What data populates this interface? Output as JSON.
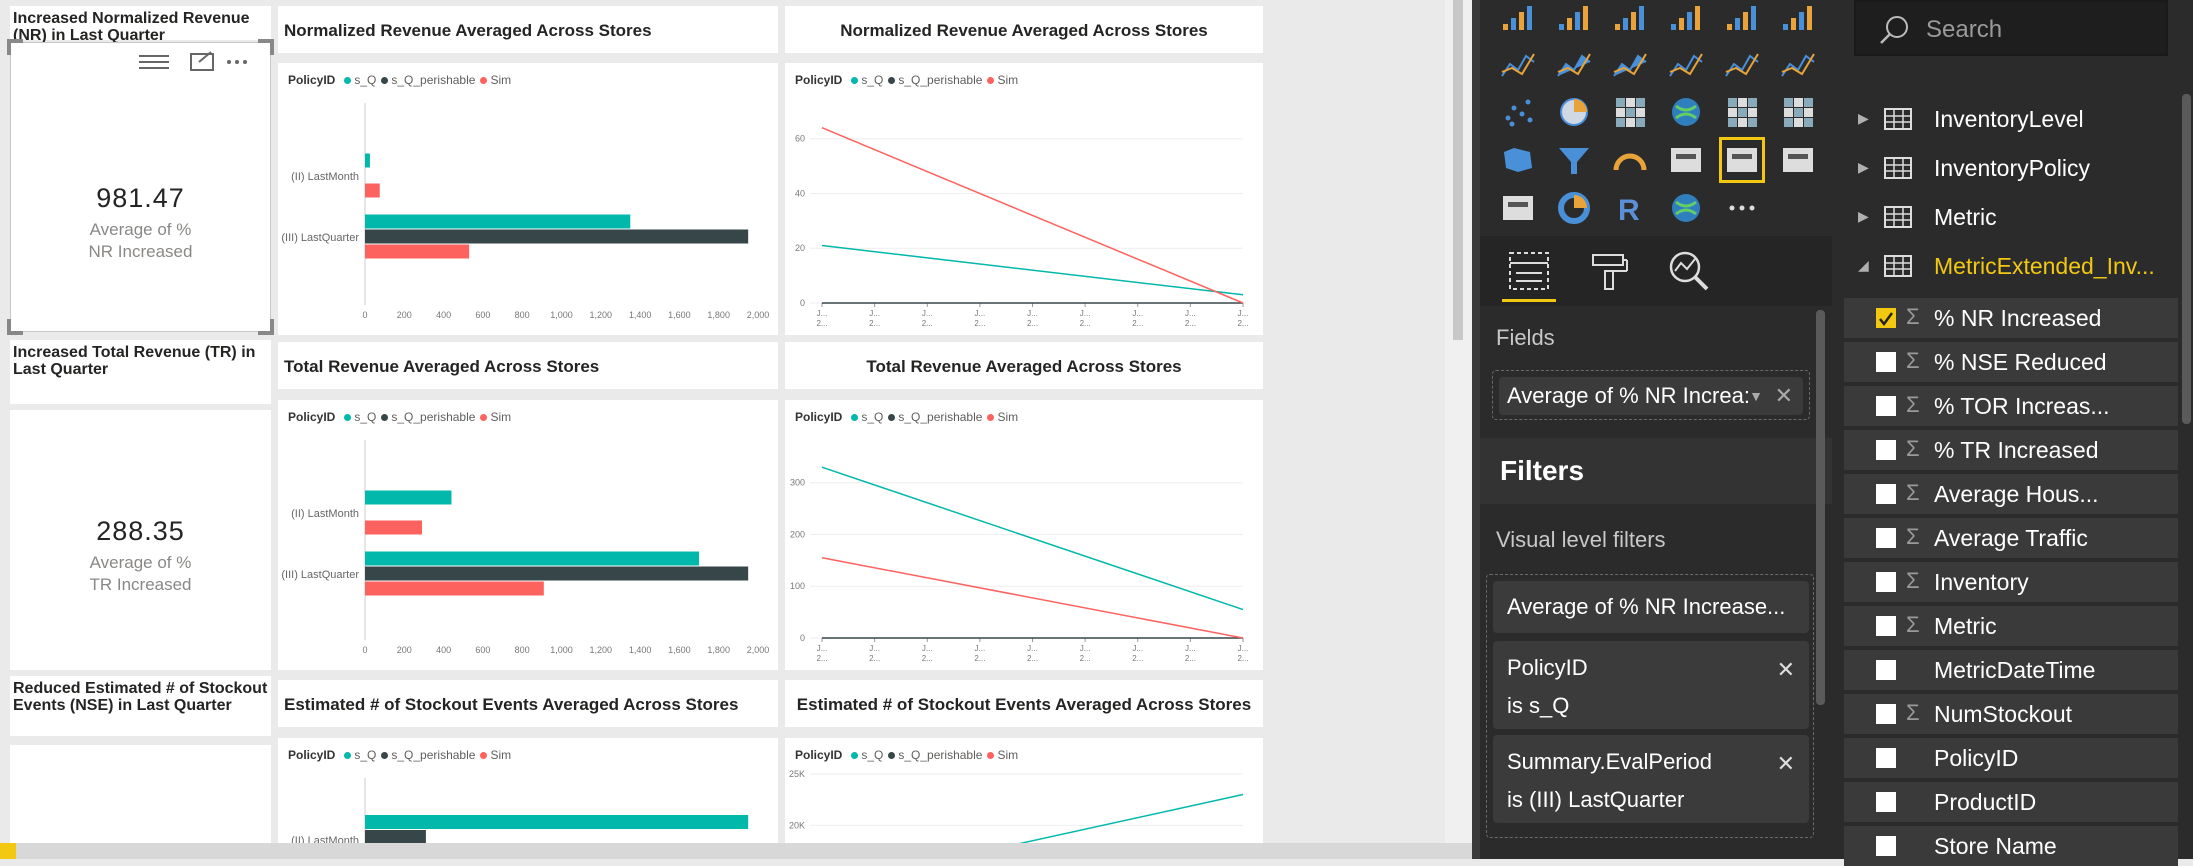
{
  "colors": {
    "sQ": "#01b8aa",
    "sQp": "#374649",
    "sim": "#fd625e",
    "accent": "#f2c811"
  },
  "kpis": [
    {
      "title": "Increased Normalized Revenue (NR) in Last Quarter",
      "value": "981.47",
      "sub": "Average of % NR Increased"
    },
    {
      "title": "Increased Total Revenue (TR) in Last Quarter",
      "value": "288.35",
      "sub": "Average of % TR Increased"
    },
    {
      "title": "Reduced Estimated # of Stockout Events (NSE) in Last Quarter",
      "value": "",
      "sub": ""
    }
  ],
  "legend": {
    "title": "PolicyID",
    "items": [
      "s_Q",
      "s_Q_perishable",
      "Sim"
    ]
  },
  "charts": [
    {
      "title": "Normalized Revenue Averaged Across Stores",
      "chart_data": {
        "type": "bar",
        "orientation": "horizontal",
        "categories": [
          "(II) LastMonth",
          "(III) LastQuarter"
        ],
        "series": [
          {
            "name": "s_Q",
            "values": [
              25,
              1350
            ]
          },
          {
            "name": "s_Q_perishable",
            "values": [
              0,
              1950
            ]
          },
          {
            "name": "Sim",
            "values": [
              75,
              530
            ]
          }
        ],
        "xlim": [
          0,
          2000
        ],
        "xticks": [
          "0",
          "200",
          "400",
          "600",
          "800",
          "1,000",
          "1,200",
          "1,400",
          "1,600",
          "1,800",
          "2,000"
        ]
      }
    },
    {
      "title": "Normalized Revenue Averaged Across Stores",
      "chart_data": {
        "type": "line",
        "x": [
          "J...",
          "J...",
          "J...",
          "J...",
          "J...",
          "J...",
          "J...",
          "J...",
          "J..."
        ],
        "series": [
          {
            "name": "s_Q",
            "values": [
              21,
              3
            ]
          },
          {
            "name": "s_Q_perishable",
            "values": [
              0,
              0
            ]
          },
          {
            "name": "Sim",
            "values": [
              64,
              0
            ]
          }
        ],
        "ylim": [
          0,
          65
        ],
        "yticks": [
          "0",
          "20",
          "40",
          "60"
        ]
      }
    },
    {
      "title": "Total Revenue Averaged Across Stores",
      "chart_data": {
        "type": "bar",
        "orientation": "horizontal",
        "categories": [
          "(II) LastMonth",
          "(III) LastQuarter"
        ],
        "series": [
          {
            "name": "s_Q",
            "values": [
              440,
              1700
            ]
          },
          {
            "name": "s_Q_perishable",
            "values": [
              0,
              1950
            ]
          },
          {
            "name": "Sim",
            "values": [
              290,
              910
            ]
          }
        ],
        "xlim": [
          0,
          2000
        ],
        "xticks": [
          "0",
          "200",
          "400",
          "600",
          "800",
          "1,000",
          "1,200",
          "1,400",
          "1,600",
          "1,800",
          "2,000"
        ]
      }
    },
    {
      "title": "Total Revenue Averaged Across Stores",
      "chart_data": {
        "type": "line",
        "x": [
          "J...",
          "J...",
          "J...",
          "J...",
          "J...",
          "J...",
          "J...",
          "J...",
          "J..."
        ],
        "series": [
          {
            "name": "s_Q",
            "values": [
              330,
              55
            ]
          },
          {
            "name": "s_Q_perishable",
            "values": [
              0,
              0
            ]
          },
          {
            "name": "Sim",
            "values": [
              155,
              0
            ]
          }
        ],
        "ylim": [
          0,
          340
        ],
        "yticks": [
          "0",
          "100",
          "200",
          "300"
        ]
      }
    },
    {
      "title": "Estimated # of Stockout Events Averaged Across Stores",
      "chart_data": {
        "type": "bar",
        "orientation": "horizontal",
        "categories": [
          "(II) LastMonth"
        ],
        "series": [
          {
            "name": "s_Q",
            "values": [
              1950
            ]
          },
          {
            "name": "s_Q_perishable",
            "values": [
              310
            ]
          }
        ],
        "xlim": [
          0,
          2000
        ],
        "xticks": []
      }
    },
    {
      "title": "Estimated # of Stockout Events Averaged Across Stores",
      "chart_data": {
        "type": "line",
        "series": [
          {
            "name": "s_Q",
            "values": [
              14000,
              23000
            ]
          }
        ],
        "ylim": [
          10000,
          25000
        ],
        "yticks": [
          "20K",
          "25K"
        ]
      }
    }
  ],
  "viz": {
    "icons": [
      "stacked-bar-icon",
      "stacked-column-icon",
      "clustered-bar-icon",
      "clustered-column-icon",
      "100-bar-icon",
      "100-column-icon",
      "line-chart-icon",
      "area-chart-icon",
      "stacked-area-icon",
      "line-column-icon",
      "line-clustered-icon",
      "ribbon-icon",
      "scatter-icon",
      "pie-icon",
      "treemap-icon",
      "map-icon",
      "table-icon",
      "matrix-icon",
      "filled-map-icon",
      "funnel-icon",
      "gauge-icon",
      "multirow-card-icon",
      "card-icon",
      "kpi-icon",
      "slicer-icon",
      "donut-icon",
      "r-visual-icon",
      "globe-icon",
      "more-icon"
    ],
    "fields_label": "Fields",
    "field_pill": "Average of % NR Increa:",
    "filters_label": "Filters",
    "visual_level_label": "Visual level filters",
    "filter_cards": [
      {
        "line1": "Average of % NR Increase...",
        "line2": ""
      },
      {
        "line1": "PolicyID",
        "line2": "is s_Q"
      },
      {
        "line1": "Summary.EvalPeriod",
        "line2": "is (III) LastQuarter"
      }
    ]
  },
  "fields": {
    "search_placeholder": "Search",
    "tables": [
      "InventoryLevel",
      "InventoryPolicy",
      "Metric",
      "MetricExtended_Inv..."
    ],
    "items": [
      {
        "label": "% NR Increased",
        "checked": true,
        "sigma": true
      },
      {
        "label": "% NSE Reduced",
        "checked": false,
        "sigma": true
      },
      {
        "label": "% TOR Increas...",
        "checked": false,
        "sigma": true
      },
      {
        "label": "% TR Increased",
        "checked": false,
        "sigma": true
      },
      {
        "label": "Average Hous...",
        "checked": false,
        "sigma": true
      },
      {
        "label": "Average Traffic",
        "checked": false,
        "sigma": true
      },
      {
        "label": "Inventory",
        "checked": false,
        "sigma": true
      },
      {
        "label": "Metric",
        "checked": false,
        "sigma": true
      },
      {
        "label": "MetricDateTime",
        "checked": false,
        "sigma": false
      },
      {
        "label": "NumStockout",
        "checked": false,
        "sigma": true
      },
      {
        "label": "PolicyID",
        "checked": false,
        "sigma": false
      },
      {
        "label": "ProductID",
        "checked": false,
        "sigma": false
      },
      {
        "label": "Store Name",
        "checked": false,
        "sigma": false
      }
    ]
  }
}
